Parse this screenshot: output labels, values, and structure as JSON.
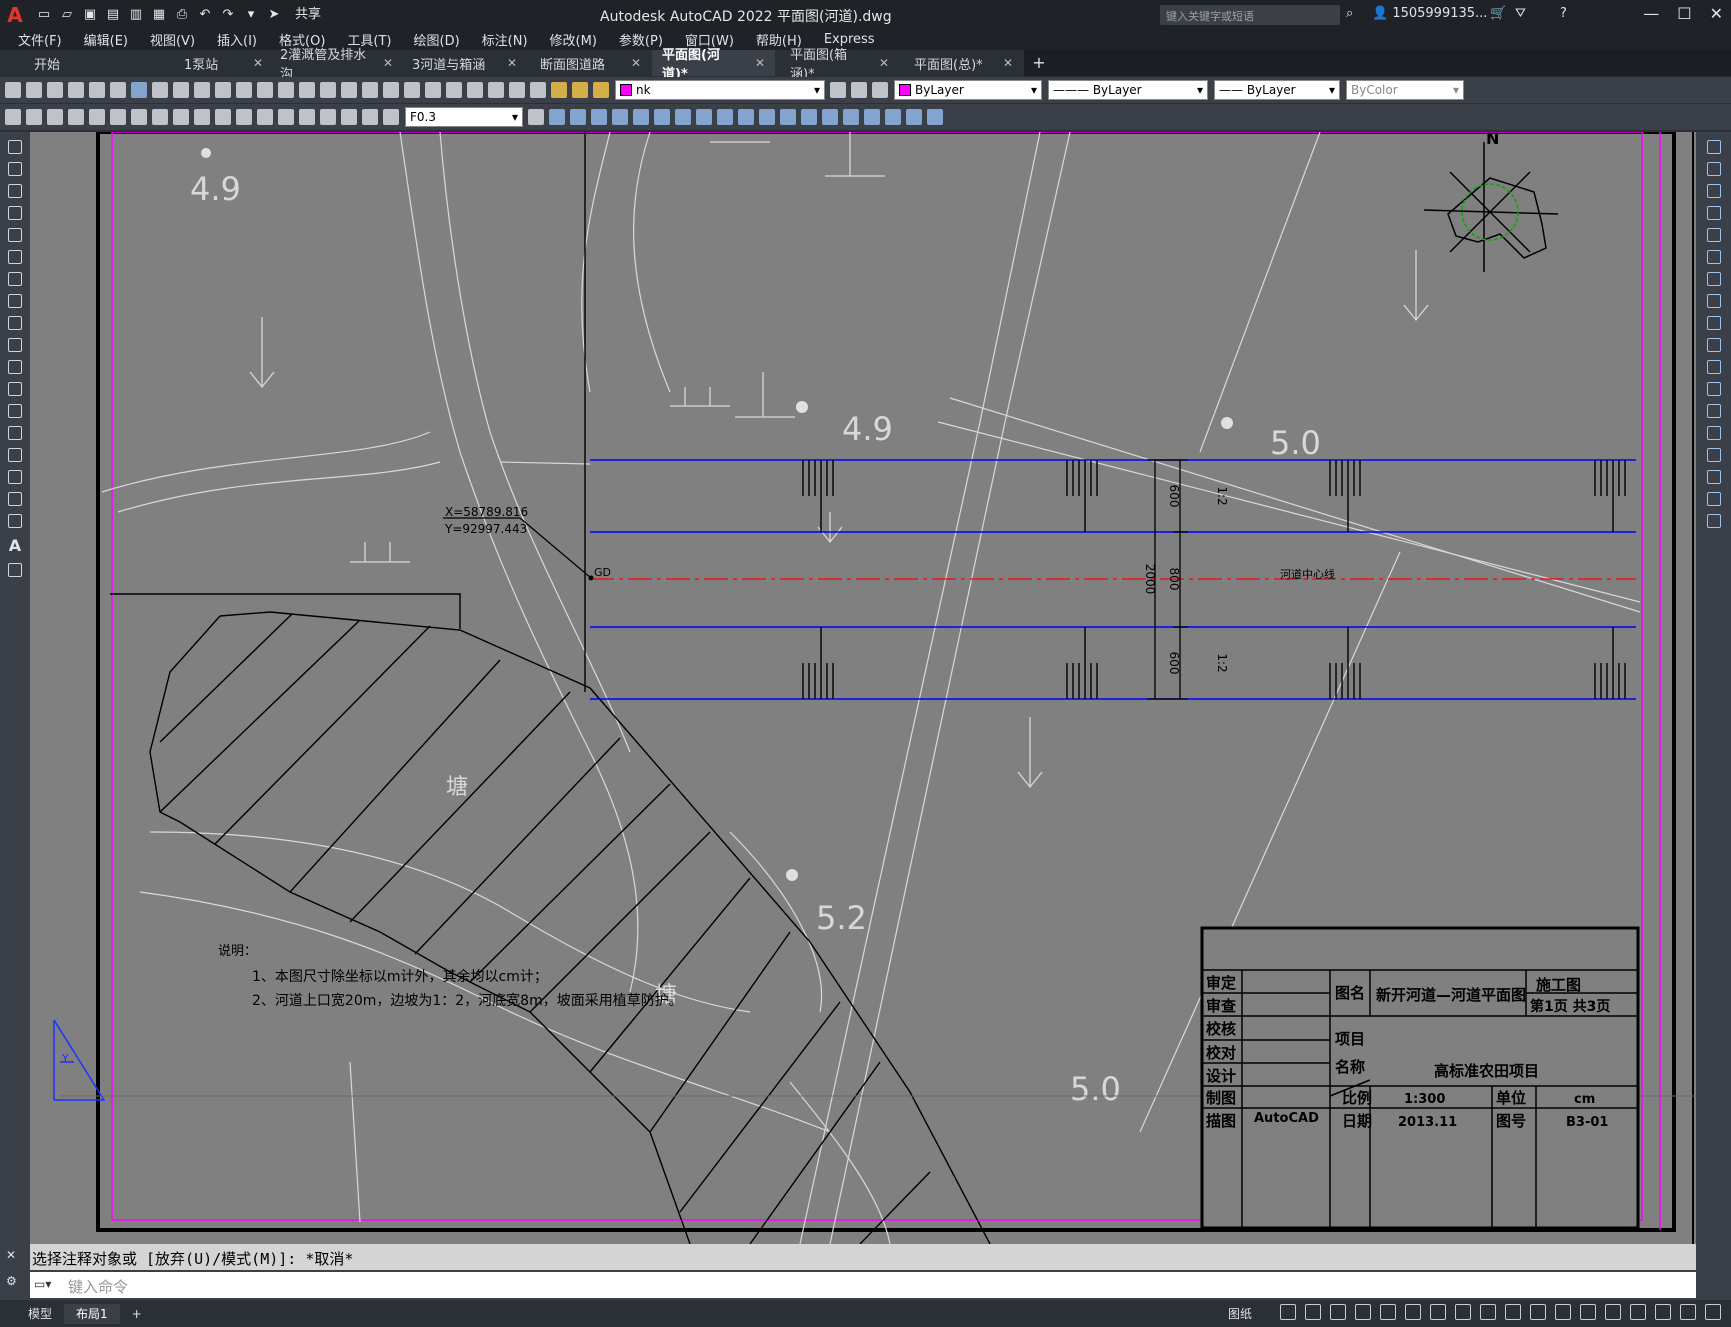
{
  "app": {
    "title": "Autodesk AutoCAD 2022    平面图(河道).dwg",
    "share": "共享",
    "search_placeholder": "键入关键字或短语",
    "user": "1505999135..."
  },
  "menu": [
    "文件(F)",
    "编辑(E)",
    "视图(V)",
    "插入(I)",
    "格式(O)",
    "工具(T)",
    "绘图(D)",
    "标注(N)",
    "修改(M)",
    "参数(P)",
    "窗口(W)",
    "帮助(H)",
    "Express"
  ],
  "tabs": [
    {
      "label": "开始",
      "active": false
    },
    {
      "label": "1泵站",
      "active": false
    },
    {
      "label": "2灌溉管及排水沟",
      "active": false
    },
    {
      "label": "3河道与箱涵",
      "active": false
    },
    {
      "label": "断面图道路",
      "active": false
    },
    {
      "label": "平面图(河道)*",
      "active": true
    },
    {
      "label": "平面图(箱涵)*",
      "active": false
    },
    {
      "label": "平面图(总)*",
      "active": false
    }
  ],
  "toolbar": {
    "layer": "nk",
    "color": "ByLayer",
    "linetype": "ByLayer",
    "lineweight": "ByLayer",
    "plotstyle": "ByColor",
    "text_style": "F0.3",
    "layer_color": "#ff00ff"
  },
  "drawing": {
    "elevations": [
      "4.9",
      "4.9",
      "5.0",
      "5.2",
      "5.0"
    ],
    "coord_x": "X=58789.816",
    "coord_y": "Y=92997.443",
    "point_label": "GD",
    "centerline_label": "河道中心线",
    "pond_label_1": "塘",
    "pond_label_2": "塘",
    "dim_600_top": "600",
    "dim_800": "800",
    "dim_600_bot": "600",
    "dim_2000": "2000",
    "slope_top": "1:2",
    "slope_bot": "1:2",
    "north": "N",
    "notes_title": "说明：",
    "note1": "1、本图尺寸除坐标以m计外，其余均以cm计；",
    "note2": "2、河道上口宽20m，边坡为1：2，河底宽8m，坡面采用植草防护。",
    "ucs_label": "Y"
  },
  "title_block": {
    "r_shending": "审定",
    "r_shencha": "审查",
    "r_jiaohe": "校核",
    "r_jiaodui": "校对",
    "r_sheji": "设计",
    "r_zhitu": "制图",
    "r_miaotu": "描图",
    "miaotu_val": "AutoCAD",
    "tuming_label": "图名",
    "tuming": "新开河道—河道平面图",
    "stage": "施工图",
    "page": "第1页  共3页",
    "project_label_1": "项目",
    "project_label_2": "名称",
    "project": "高标准农田项目",
    "scale_label": "比例",
    "scale": "1:300",
    "unit_label": "单位",
    "unit": "cm",
    "date_label": "日期",
    "date": "2013.11",
    "no_label": "图号",
    "no": "B3-01"
  },
  "command": {
    "history": "选择注释对象或 [放弃(U)/模式(M)]: *取消*",
    "placeholder": "键入命令"
  },
  "status": {
    "tab_model": "模型",
    "tab_layout": "布局1",
    "paper": "图纸"
  }
}
